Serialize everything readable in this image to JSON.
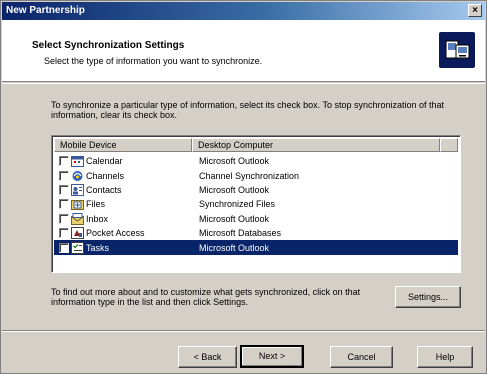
{
  "window": {
    "title": "New Partnership",
    "close_glyph": "×"
  },
  "header": {
    "title": "Select Synchronization Settings",
    "subtitle": "Select the type of information you want to synchronize.",
    "icon": "sync-settings-icon"
  },
  "intro_text": "To synchronize a particular type of information, select its check box. To stop synchronization of that information, clear its check box.",
  "list": {
    "columns": [
      "Mobile Device",
      "Desktop Computer"
    ],
    "rows": [
      {
        "device": "Calendar",
        "desktop": "Microsoft Outlook",
        "icon": "calendar-icon",
        "checked": false,
        "selected": false
      },
      {
        "device": "Channels",
        "desktop": "Channel Synchronization",
        "icon": "channels-icon",
        "checked": false,
        "selected": false
      },
      {
        "device": "Contacts",
        "desktop": "Microsoft Outlook",
        "icon": "contacts-icon",
        "checked": false,
        "selected": false
      },
      {
        "device": "Files",
        "desktop": "Synchronized Files",
        "icon": "files-icon",
        "checked": false,
        "selected": false
      },
      {
        "device": "Inbox",
        "desktop": "Microsoft Outlook",
        "icon": "inbox-icon",
        "checked": false,
        "selected": false
      },
      {
        "device": "Pocket Access",
        "desktop": "Microsoft Databases",
        "icon": "pocket-access-icon",
        "checked": false,
        "selected": false
      },
      {
        "device": "Tasks",
        "desktop": "Microsoft Outlook",
        "icon": "tasks-icon",
        "checked": false,
        "selected": true
      }
    ]
  },
  "settings_text": "To find out more about and to customize what gets synchronized, click on that information type in the list and then click Settings.",
  "buttons": {
    "settings": "Settings...",
    "back": "< Back",
    "next": "Next >",
    "cancel": "Cancel",
    "help": "Help"
  },
  "colors": {
    "title_bar": "#0a246a",
    "selection": "#0a246a",
    "dialog_face": "#d4d0c8"
  }
}
